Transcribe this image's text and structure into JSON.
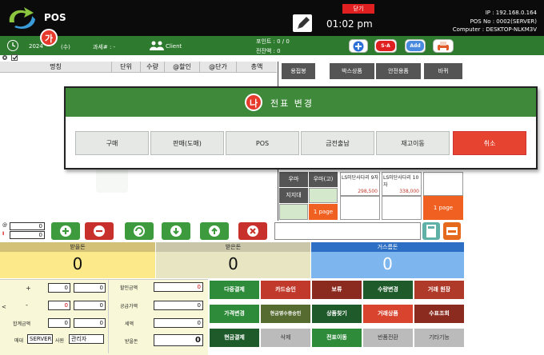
{
  "header": {
    "app_name": "POS",
    "close_label": "닫기",
    "time": "01:02 pm",
    "ip_line": "IP : 192.168.0.164",
    "posno_line": "POS No : 0002(SERVER)",
    "computer_line": "Computer : DESKTOP-NLKM3V"
  },
  "statusbar": {
    "date": "2024",
    "date_suffix": "(수)",
    "tax_label": "과세# : -",
    "client": "Client",
    "points": "포인트 : 0 / 0",
    "cash_change": "전잔액 : 0",
    "sa_label": "S-A",
    "add_label": "Add",
    "badge_a": "가"
  },
  "grid": {
    "columns": [
      "명칭",
      "단위",
      "수량",
      "@할인",
      "@단가",
      "총액"
    ]
  },
  "categories": [
    "용접봉",
    "박스상품",
    "안전용품",
    "바퀴"
  ],
  "dialog": {
    "badge": "나",
    "title": "전표 변경",
    "buttons": [
      "구매",
      "판매(도매)",
      "POS",
      "금전출납",
      "재고이동"
    ],
    "cancel": "취소"
  },
  "product_grid": {
    "items": [
      {
        "name": "우마",
        "type": "cat"
      },
      {
        "name": "우마(고)",
        "type": "cat"
      },
      {
        "name": "지지대",
        "type": "cat"
      }
    ],
    "products": [
      {
        "name": "LS미단사다리 9자",
        "price": "298,500"
      },
      {
        "name": "LS미단사다리 10자",
        "price": "338,000"
      }
    ],
    "page_label": "1 page",
    "page_label2": "1 page"
  },
  "qty_rows": {
    "row1_value": "0",
    "row2_value": "0"
  },
  "totals": {
    "received_label": "받을돈",
    "received_value": "0",
    "paid_label": "받은돈",
    "paid_value": "0",
    "change_label": "거스름돈",
    "change_value": "0"
  },
  "left_panel": {
    "plus_label": "+",
    "minus_label": "-",
    "total_label": "합계금액",
    "store_label": "매대",
    "store_value": "SERVER",
    "staff_label": "사원",
    "staff_value": "관리자",
    "row_vals": [
      "0",
      "0",
      "0",
      "0",
      "0",
      "0"
    ],
    "discount_label": "할인금액",
    "supply_label": "공급가액",
    "tax_label": "세액",
    "back_label": "받을돈",
    "right_vals": [
      "0",
      "0",
      "0",
      "0"
    ]
  },
  "function_buttons": [
    {
      "label": "다중결제",
      "color": "#2e8b3a"
    },
    {
      "label": "카드승인",
      "color": "#c0392b"
    },
    {
      "label": "보류",
      "color": "#8b2a1e"
    },
    {
      "label": "수량변경",
      "color": "#1e5a2a"
    },
    {
      "label": "거래 원장",
      "color": "#b03a2a"
    },
    {
      "label": "가격변경",
      "color": "#2e8b3a"
    },
    {
      "label": "현금영수증승인",
      "color": "#556b2f"
    },
    {
      "label": "상품찾기",
      "color": "#1e5a2a"
    },
    {
      "label": "거래상품",
      "color": "#d9442f"
    },
    {
      "label": "수표조회",
      "color": "#8b2a1e"
    },
    {
      "label": "현금결제",
      "color": "#1e5a2a"
    },
    {
      "label": "삭제",
      "color": "#bbbbbb"
    },
    {
      "label": "전표이동",
      "color": "#2e8b3a"
    },
    {
      "label": "반품전환",
      "color": "#bbbbbb"
    },
    {
      "label": "기타기능",
      "color": "#bbbbbb"
    }
  ]
}
